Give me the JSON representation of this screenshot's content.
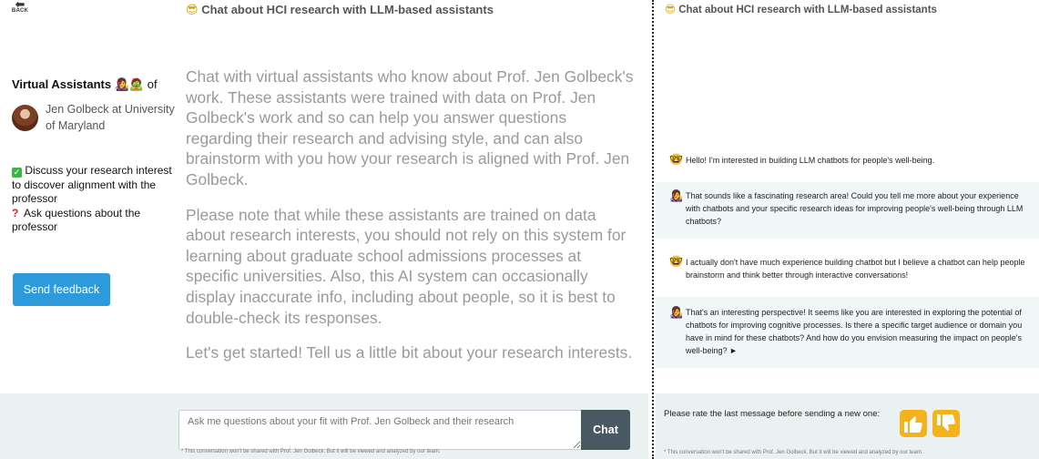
{
  "left": {
    "back_label": "BACK",
    "header_emoji": "😎",
    "header_title": "Chat about HCI research with LLM-based assistants",
    "sidebar": {
      "title_prefix": "Virtual Assistants",
      "title_emoji": "👩‍🎤🧟",
      "title_suffix": "of",
      "profile_text": "Jen Golbeck at University of Maryland",
      "features": [
        {
          "icon": "✓",
          "text": "Discuss your research interest to discover alignment with the professor"
        },
        {
          "icon": "?",
          "text": "Ask questions about the professor"
        }
      ],
      "feedback_label": "Send feedback"
    },
    "intro": [
      "Chat with virtual assistants who know about Prof. Jen Golbeck's work. These assistants were trained with data on Prof. Jen Golbeck's work and so can help you answer questions regarding their research and advising style, and can also brainstorm with you how your research is aligned with Prof. Jen Golbeck.",
      "Please note that while these assistants are trained on data about research interests, you should not rely on this system for learning about graduate school admissions processes at specific universities. Also, this AI system can occasionally display inaccurate info, including about people, so it is best to double-check its responses.",
      "Let's get started! Tell us a little bit about your research interests."
    ],
    "input_placeholder": "Ask me questions about your fit with Prof. Jen Golbeck and their research",
    "chat_label": "Chat",
    "footnote": "* This conversation won't be shared with Prof. Jen Golbeck. But it will be viewed and analyzed by our team."
  },
  "right": {
    "header_emoji": "😎",
    "header_title": "Chat about HCI research with LLM-based assistants",
    "messages": [
      {
        "role": "user",
        "icon": "🤓",
        "text": "Hello! I'm interested in building LLM chatbots for people's well-being."
      },
      {
        "role": "assistant",
        "icon": "👩‍🎤",
        "text": "That sounds like a fascinating research area! Could you tell me more about your experience with chatbots and your specific research ideas for improving people's well-being through LLM chatbots?"
      },
      {
        "role": "user",
        "icon": "🤓",
        "text": "I actually don't have much experience building chatbot but I believe a chatbot can help people brainstorm and think better through interactive conversations!"
      },
      {
        "role": "assistant",
        "icon": "👩‍🎤",
        "text": "That's an interesting perspective! It seems like you are interested in exploring the potential of chatbots for improving cognitive processes. Is there a specific target audience or domain you have in mind for these chatbots? And how do you envision measuring the impact on people's well-being? ►"
      }
    ],
    "rate_text": "Please rate the last message before sending a new one:",
    "footnote": "* This conversation won't be shared with Prof. Jen Golbeck. But it will be viewed and analyzed by our team."
  }
}
